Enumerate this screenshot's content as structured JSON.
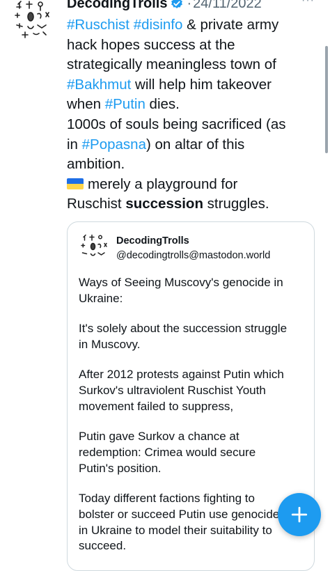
{
  "tweet": {
    "author": "DecodingTrolls",
    "date_separator": "·",
    "date": "24/11/2022",
    "more_label": "···",
    "lines": [
      [
        {
          "t": "#Ruschist",
          "tag": true
        },
        {
          "t": " "
        },
        {
          "t": "#disinfo",
          "tag": true
        },
        {
          "t": " & private army"
        }
      ],
      [
        {
          "t": "hack hopes success at the"
        }
      ],
      [
        {
          "t": "strategically meaningless town of"
        }
      ],
      [
        {
          "t": "#Bakhmut",
          "tag": true
        },
        {
          "t": " will help him takeover"
        }
      ],
      [
        {
          "t": "when "
        },
        {
          "t": "#Putin",
          "tag": true
        },
        {
          "t": " dies."
        }
      ],
      [
        {
          "t": "1000s of souls being sacrificed (as"
        }
      ],
      [
        {
          "t": "in "
        },
        {
          "t": "#Popasna",
          "tag": true
        },
        {
          "t": ") on altar of this"
        }
      ],
      [
        {
          "t": "ambition."
        }
      ],
      [
        {
          "flag": "ukraine"
        },
        {
          "t": "merely a playground for"
        }
      ],
      [
        {
          "t": "Ruschist "
        },
        {
          "t": "succession",
          "bold": true
        },
        {
          "t": " struggles."
        }
      ]
    ]
  },
  "quoted": {
    "name": "DecodingTrolls",
    "handle": "@decodingtrolls@mastodon.world",
    "paragraphs": [
      [
        "Ways of Seeing Muscovy's genocide in",
        "Ukraine:"
      ],
      [
        "It's solely about the succession struggle",
        "in Muscovy."
      ],
      [
        "After 2012 protests against Putin which",
        "Surkov's ultraviolent Ruschist Youth",
        "movement failed to suppress,"
      ],
      [
        "Putin gave Surkov a chance at",
        "redemption: Crimea would secure",
        "Putin's position."
      ],
      [
        "Today different factions fighting to",
        "bolster or succeed Putin use genocide",
        "in Ukraine to model their suitability to",
        "succeed."
      ]
    ]
  },
  "icons": {
    "avatar": "decodingtrolls-avatar-icon",
    "verified": "verified-badge-icon",
    "fab": "plus-icon"
  },
  "colors": {
    "link": "#1d9bf0",
    "text": "#0f1419",
    "muted": "#536471",
    "fab": "#1d9bf0"
  }
}
